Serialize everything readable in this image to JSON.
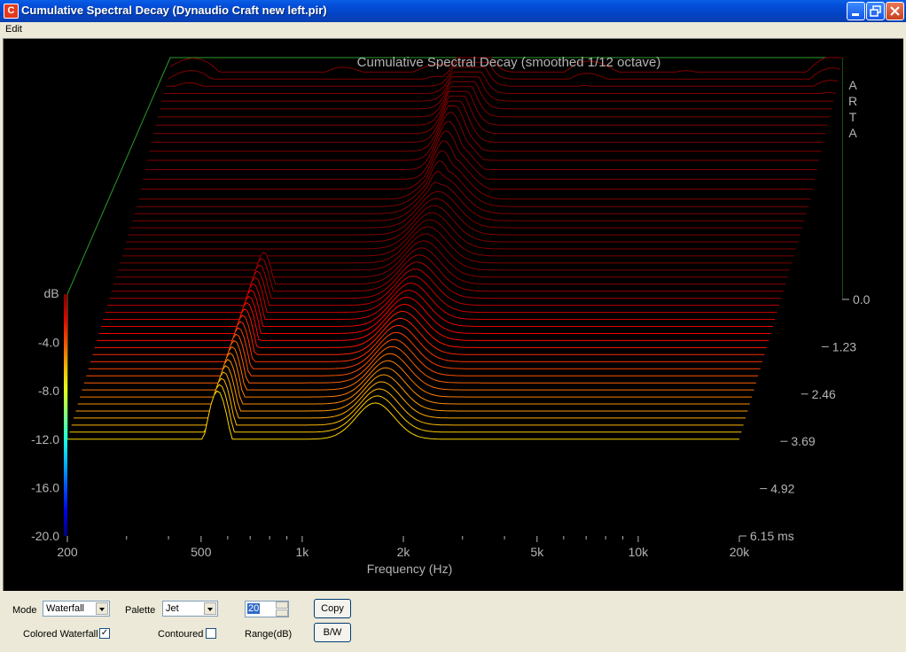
{
  "window": {
    "title": "Cumulative Spectral Decay  (Dynaudio Craft new left.pir)",
    "app_icon_letter": "C"
  },
  "menu": {
    "edit": "Edit"
  },
  "plot": {
    "title": "Cumulative Spectral Decay (smoothed 1/12 octave)",
    "brand_letters": [
      "A",
      "R",
      "T",
      "A"
    ],
    "ylabel": "dB",
    "xlabel": "Frequency (Hz)",
    "colors": {
      "background": "#000000",
      "frame": "#2a9a2a",
      "text": "#b4b4b4"
    }
  },
  "chart_data": {
    "type": "waterfall",
    "title": "Cumulative Spectral Decay (smoothed 1/12 octave)",
    "xlabel": "Frequency (Hz)",
    "ylabel": "dB",
    "x_scale": "log",
    "x_ticks": [
      {
        "value": 200,
        "label": "200"
      },
      {
        "value": 500,
        "label": "500"
      },
      {
        "value": 1000,
        "label": "1k"
      },
      {
        "value": 2000,
        "label": "2k"
      },
      {
        "value": 5000,
        "label": "5k"
      },
      {
        "value": 10000,
        "label": "10k"
      },
      {
        "value": 20000,
        "label": "20k"
      }
    ],
    "x_minor_ticks": [
      300,
      400,
      600,
      700,
      800,
      900,
      3000,
      4000,
      6000,
      7000,
      8000,
      9000
    ],
    "y_ticks": [
      {
        "value": 0,
        "label": ""
      },
      {
        "value": -4,
        "label": "-4.0"
      },
      {
        "value": -8,
        "label": "-8.0"
      },
      {
        "value": -12,
        "label": "-12.0"
      },
      {
        "value": -16,
        "label": "-16.0"
      },
      {
        "value": -20,
        "label": "-20.0"
      }
    ],
    "ylim": [
      -20,
      0
    ],
    "time_ticks": [
      {
        "value": 0,
        "label": "0.0"
      },
      {
        "value": 1.23,
        "label": "1.23"
      },
      {
        "value": 2.46,
        "label": "2.46"
      },
      {
        "value": 3.69,
        "label": "3.69"
      },
      {
        "value": 4.92,
        "label": "4.92"
      },
      {
        "value": 6.15,
        "label": "6.15 ms"
      }
    ],
    "time_range_ms": [
      0,
      6.15
    ],
    "slices": 50,
    "palette": "Jet",
    "colorbar_range_db": [
      -20,
      0
    ]
  },
  "controls": {
    "mode_label": "Mode",
    "mode_value": "Waterfall",
    "palette_label": "Palette",
    "palette_value": "Jet",
    "range_value": "20",
    "range_label": "Range(dB)",
    "copy_label": "Copy",
    "bw_label": "B/W",
    "colored_waterfall_label": "Colored Waterfall",
    "colored_waterfall_checked": "✓",
    "contoured_label": "Contoured"
  }
}
